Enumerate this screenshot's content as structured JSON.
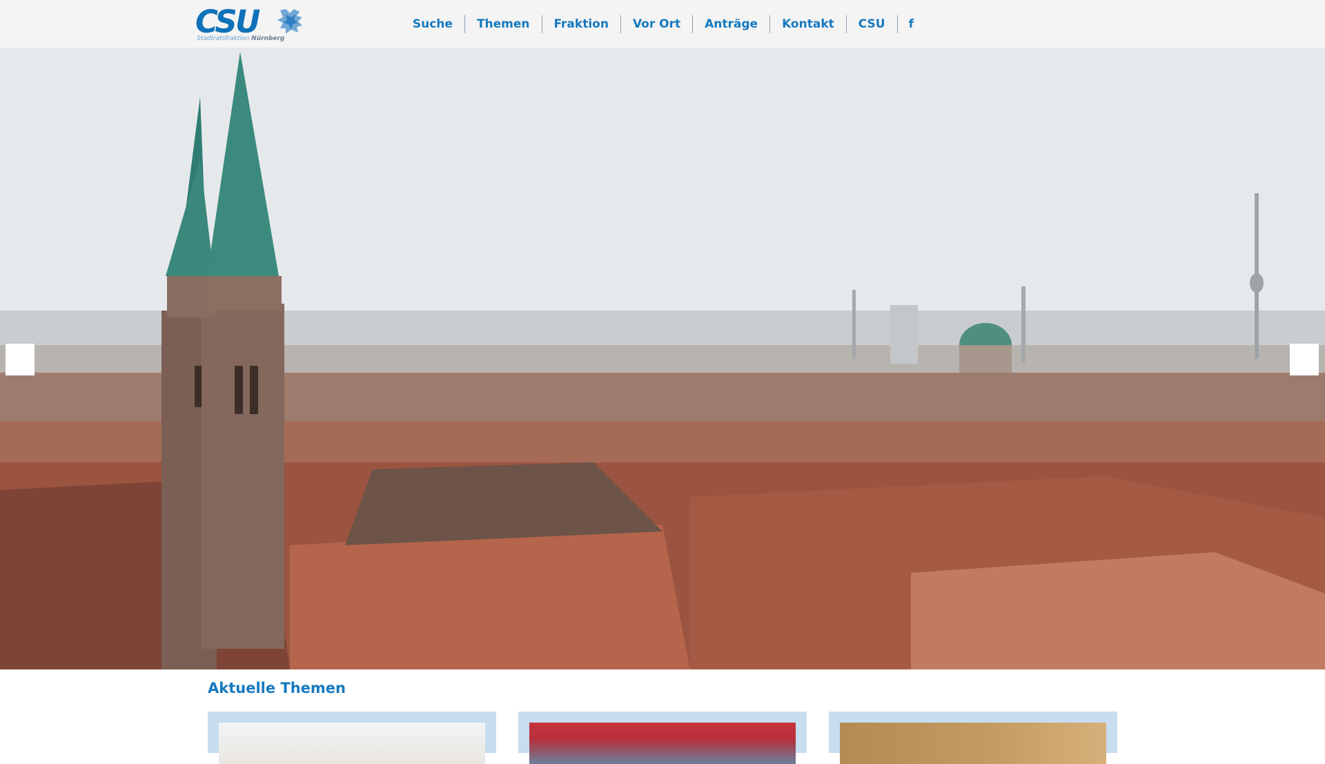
{
  "brand": {
    "logo_text": "CSU",
    "logo_subtitle": "Stadtratsfraktion",
    "logo_city": "Nürnberg",
    "color": "#1579bf"
  },
  "nav": {
    "items": [
      {
        "label": "Suche"
      },
      {
        "label": "Themen"
      },
      {
        "label": "Fraktion"
      },
      {
        "label": "Vor Ort"
      },
      {
        "label": "Anträge"
      },
      {
        "label": "Kontakt"
      },
      {
        "label": "CSU"
      },
      {
        "label": "f",
        "icon": "facebook-icon"
      }
    ]
  },
  "hero": {
    "image": "nuremberg-cityscape-photo",
    "prev_icon": "arrow-left-icon",
    "next_icon": "arrow-right-icon"
  },
  "content": {
    "section_title": "Aktuelle Themen",
    "cards": [
      {
        "image": "news-photo-1"
      },
      {
        "image": "stadium-photo"
      },
      {
        "image": "portrait-photo"
      }
    ]
  }
}
